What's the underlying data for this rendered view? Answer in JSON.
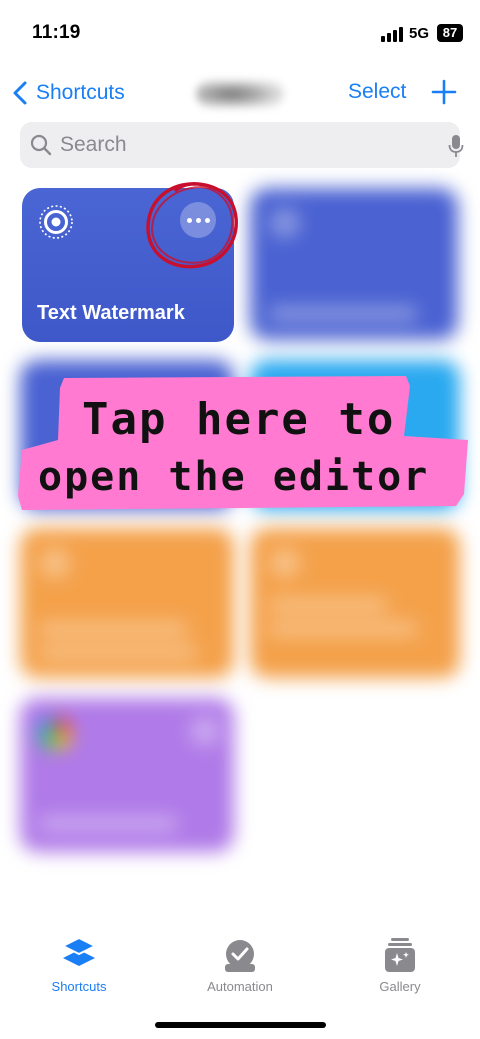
{
  "status_bar": {
    "time": "11:19",
    "network": "5G",
    "battery": "87"
  },
  "nav": {
    "back_label": "Shortcuts",
    "select_label": "Select"
  },
  "search": {
    "placeholder": "Search"
  },
  "shortcuts": [
    {
      "label": "Text Watermark",
      "color": "#4a62d2",
      "icon": "target-icon"
    }
  ],
  "annotation": {
    "line1": "Tap here to",
    "line2": "open the editor",
    "banner_color": "#ff7ad0",
    "circle_color": "#c8102e"
  },
  "tabbar": {
    "tabs": [
      {
        "label": "Shortcuts",
        "icon": "layers-icon",
        "active": true
      },
      {
        "label": "Automation",
        "icon": "clock-check-icon",
        "active": false
      },
      {
        "label": "Gallery",
        "icon": "gallery-sparkle-icon",
        "active": false
      }
    ]
  },
  "colors": {
    "accent": "#1a7ef5",
    "tile_blue": "#4a62d2",
    "tile_cyan": "#2aa9f0",
    "tile_orange": "#f4a14a",
    "tile_purple": "#b07ae8"
  }
}
